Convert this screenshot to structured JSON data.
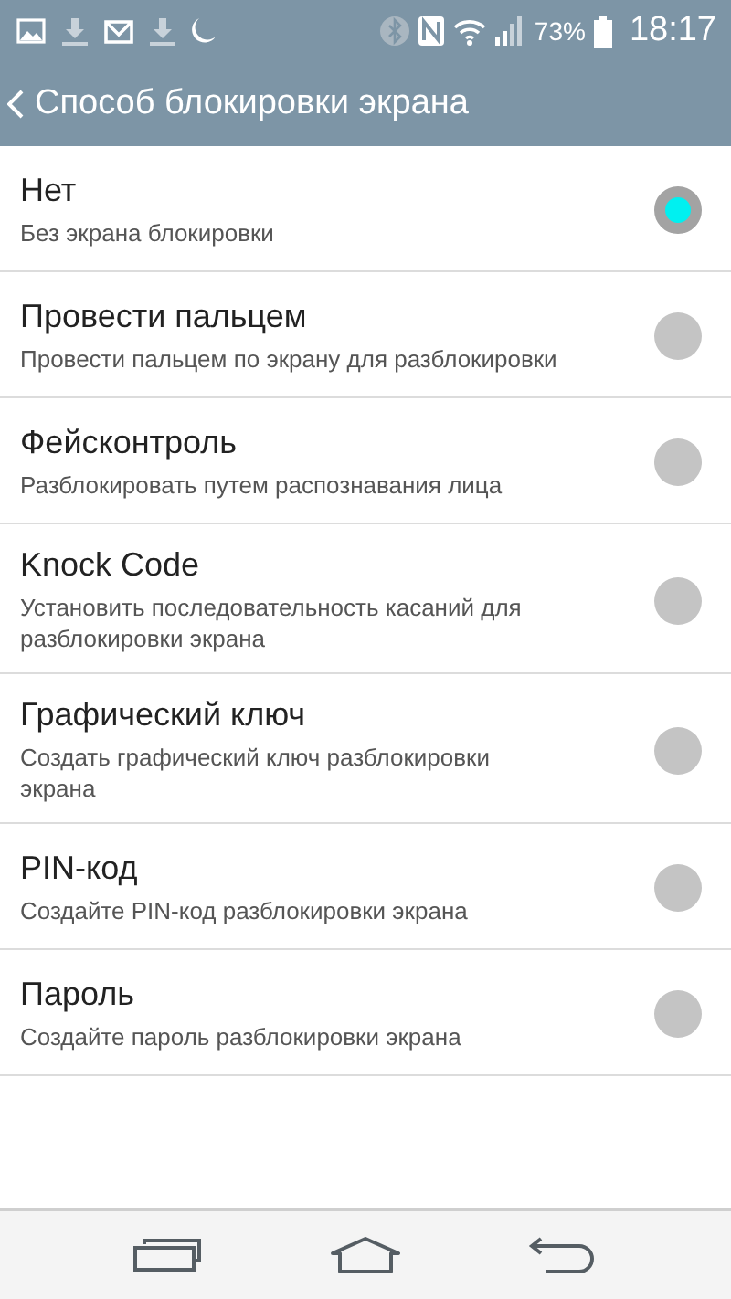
{
  "status_bar": {
    "battery": "73%",
    "time": "18:17"
  },
  "header": {
    "title": "Способ блокировки экрана"
  },
  "options": [
    {
      "title": "Нет",
      "subtitle": "Без экрана блокировки",
      "selected": true
    },
    {
      "title": "Провести пальцем",
      "subtitle": "Провести пальцем по экрану для разблокировки",
      "selected": false
    },
    {
      "title": "Фейсконтроль",
      "subtitle": "Разблокировать путем распознавания лица",
      "selected": false
    },
    {
      "title": "Knock Code",
      "subtitle": "Установить последовательность касаний для разблокировки экрана",
      "selected": false
    },
    {
      "title": "Графический ключ",
      "subtitle": "Создать графический ключ разблокировки экрана",
      "selected": false
    },
    {
      "title": "PIN-код",
      "subtitle": "Создайте PIN-код разблокировки экрана",
      "selected": false
    },
    {
      "title": "Пароль",
      "subtitle": "Создайте пароль разблокировки экрана",
      "selected": false
    }
  ]
}
